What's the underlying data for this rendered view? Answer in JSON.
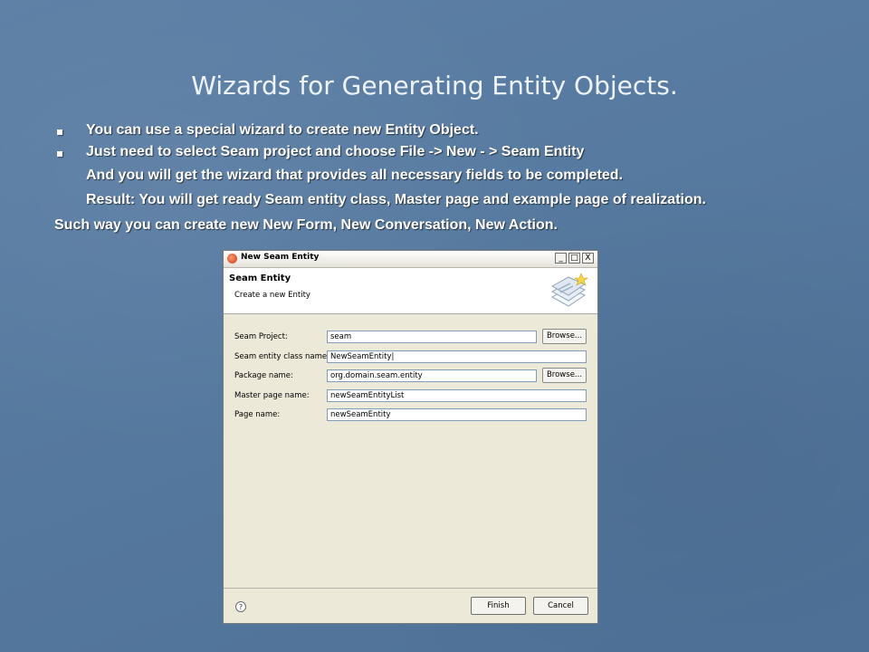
{
  "slide": {
    "title": "Wizards for Generating Entity Objects.",
    "bullet1": "You can use a special wizard to create new Entity Object.",
    "bullet2": "Just need to select Seam project and choose  File -> New - > Seam Entity",
    "line3": "And you will get the wizard that provides all necessary fields to be completed.",
    "line4": "Result: You will get ready Seam entity class, Master page and example page of realization.",
    "line5": "Such way you can create new New Form, New Conversation, New Action."
  },
  "dialog": {
    "window_title": "New Seam Entity",
    "window_buttons": [
      "_",
      "□",
      "X"
    ],
    "heading": "Seam Entity",
    "description": "Create a new Entity",
    "fields": [
      {
        "label": "Seam Project:",
        "value": "seam"
      },
      {
        "label": "Seam entity class name:",
        "value": "NewSeamEntity|"
      },
      {
        "label": "Package name:",
        "value": "org.domain.seam.entity"
      },
      {
        "label": "Master page name:",
        "value": "newSeamEntityList"
      },
      {
        "label": "Page name:",
        "value": "newSeamEntity"
      }
    ],
    "browse_label": "Browse...",
    "help_symbol": "?",
    "finish_label": "Finish",
    "cancel_label": "Cancel"
  },
  "colors": {
    "background": "#56799f",
    "title_text": "#eef3f9",
    "dialog_bg": "#ece9d8",
    "field_border": "#7f9db9"
  },
  "icons": [
    "wizard-banner-icon",
    "app-icon",
    "help-icon"
  ]
}
